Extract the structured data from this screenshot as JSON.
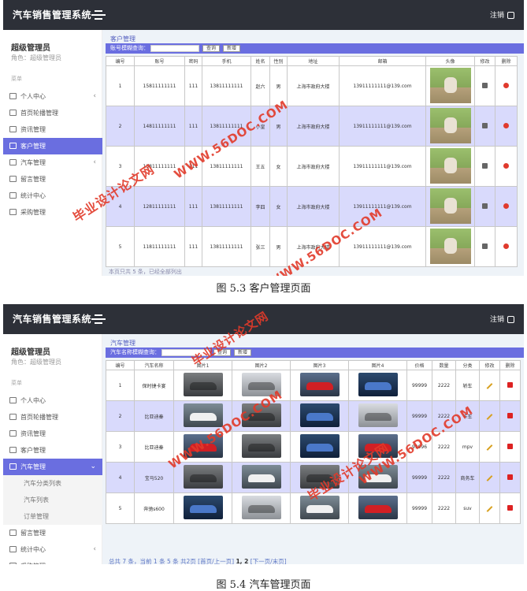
{
  "app_title": "汽车销售管理系统",
  "logout_label": "注销",
  "user": {
    "name": "超级管理员",
    "role": "角色：超级管理员"
  },
  "menu_title": "菜单",
  "screen1": {
    "menu": [
      {
        "label": "个人中心",
        "arrow": "‹"
      },
      {
        "label": "首页轮播管理",
        "arrow": ""
      },
      {
        "label": "资讯管理",
        "arrow": ""
      },
      {
        "label": "客户管理",
        "arrow": "",
        "active": true
      },
      {
        "label": "汽车管理",
        "arrow": "‹"
      },
      {
        "label": "留言管理",
        "arrow": ""
      },
      {
        "label": "统计中心",
        "arrow": ""
      },
      {
        "label": "采购管理",
        "arrow": ""
      }
    ],
    "content_title": "客户管理",
    "search_label": "账号模糊查询：",
    "search_btn": "查询",
    "add_btn": "新增",
    "columns": [
      "编号",
      "账号",
      "密码",
      "手机",
      "姓名",
      "性别",
      "地址",
      "邮箱",
      "头像",
      "修改",
      "删除"
    ],
    "rows": [
      [
        "1",
        "15811111111",
        "111",
        "13811111111",
        "赵六",
        "男",
        "上海市政府大楼",
        "13911111111@139.com"
      ],
      [
        "2",
        "14811111111",
        "111",
        "13811111111",
        "小皇",
        "男",
        "上海市政府大楼",
        "13911111111@139.com"
      ],
      [
        "3",
        "13811111111",
        "111",
        "13811111111",
        "王五",
        "女",
        "上海市政府大楼",
        "13911111111@139.com"
      ],
      [
        "4",
        "12811111111",
        "111",
        "13811111111",
        "李四",
        "女",
        "上海市政府大楼",
        "13911111111@139.com"
      ],
      [
        "5",
        "11811111111",
        "111",
        "13811111111",
        "张三",
        "男",
        "上海市政府大楼",
        "13911111111@139.com"
      ]
    ],
    "footer_stub": "本页只共 5 条，已经全部列出"
  },
  "caption1": "图 5.3 客户管理页面",
  "screen2": {
    "menu": [
      {
        "label": "个人中心",
        "arrow": ""
      },
      {
        "label": "首页轮播管理",
        "arrow": ""
      },
      {
        "label": "资讯管理",
        "arrow": ""
      },
      {
        "label": "客户管理",
        "arrow": ""
      },
      {
        "label": "汽车管理",
        "arrow": "⌄",
        "active": true
      }
    ],
    "submenu": [
      "汽车分类列表",
      "汽车列表",
      "订单管理"
    ],
    "menu_after": [
      {
        "label": "留言管理",
        "arrow": ""
      },
      {
        "label": "统计中心",
        "arrow": "‹"
      },
      {
        "label": "采购管理",
        "arrow": ""
      }
    ],
    "content_title": "汽车管理",
    "search_label": "汽车名称模糊查询：",
    "search_btn": "查询",
    "add_btn": "新增",
    "columns": [
      "编号",
      "汽车名称",
      "图片1",
      "图片2",
      "图片3",
      "图片4",
      "价格",
      "数量",
      "分类",
      "修改",
      "删除"
    ],
    "rows": [
      [
        "1",
        "保时捷卡宴",
        "99999",
        "2222",
        "轿车"
      ],
      [
        "2",
        "比亚迪秦",
        "99999",
        "2222",
        "卡车"
      ],
      [
        "3",
        "比亚迪秦",
        "99996",
        "2222",
        "mpv"
      ],
      [
        "4",
        "宝马520",
        "99999",
        "2222",
        "商务车"
      ],
      [
        "5",
        "奔驰s600",
        "99999",
        "2222",
        "suv"
      ]
    ],
    "pager": {
      "summary": "总共 7 条，当前 1 条 5 条 共2页",
      "first_prev": "[首页/上一页]",
      "pages": "1, 2",
      "next_last": "[下一页/末页]"
    }
  },
  "caption2": "图 5.4 汽车管理页面",
  "watermarks": {
    "domain": "WWW.56DOC.COM",
    "cn": "毕业设计论文网"
  }
}
